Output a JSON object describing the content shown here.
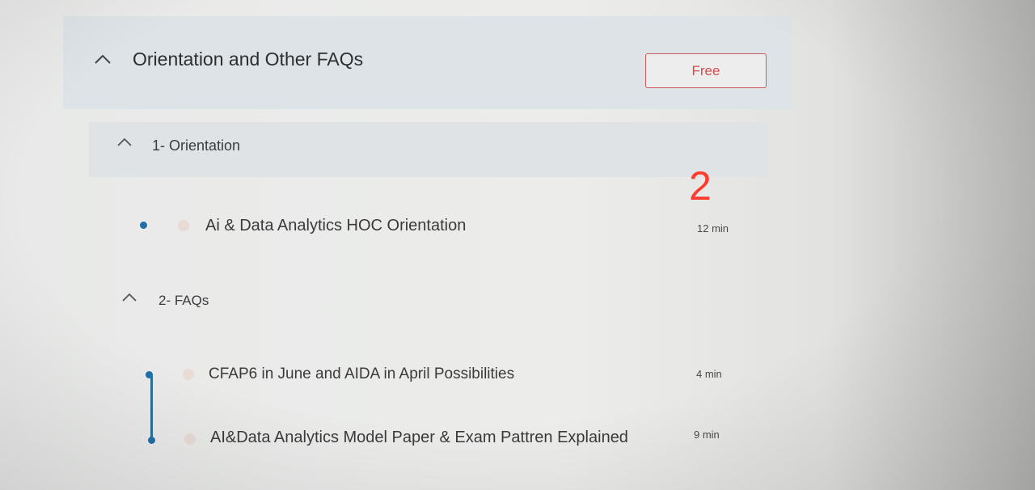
{
  "section": {
    "title": "Orientation and Other FAQs",
    "badge": "Free"
  },
  "subsections": [
    {
      "title": "1- Orientation",
      "lessons": [
        {
          "title": "Ai & Data Analytics HOC Orientation",
          "duration": "12 min"
        }
      ]
    },
    {
      "title": "2- FAQs",
      "lessons": [
        {
          "title": "CFAP6 in June and AIDA in April Possibilities",
          "duration": "4 min"
        },
        {
          "title": "AI&Data Analytics Model Paper & Exam Pattren Explained",
          "duration": "9 min"
        }
      ]
    }
  ],
  "annotation": {
    "text": "2",
    "color": "#ff3b30"
  },
  "icons": {
    "collapse": "chevron-up-icon",
    "lesson_progress": "dot-icon",
    "lesson_type": "play-icon"
  },
  "colors": {
    "accent": "#d74b4b",
    "progress": "#1f6fa8"
  }
}
